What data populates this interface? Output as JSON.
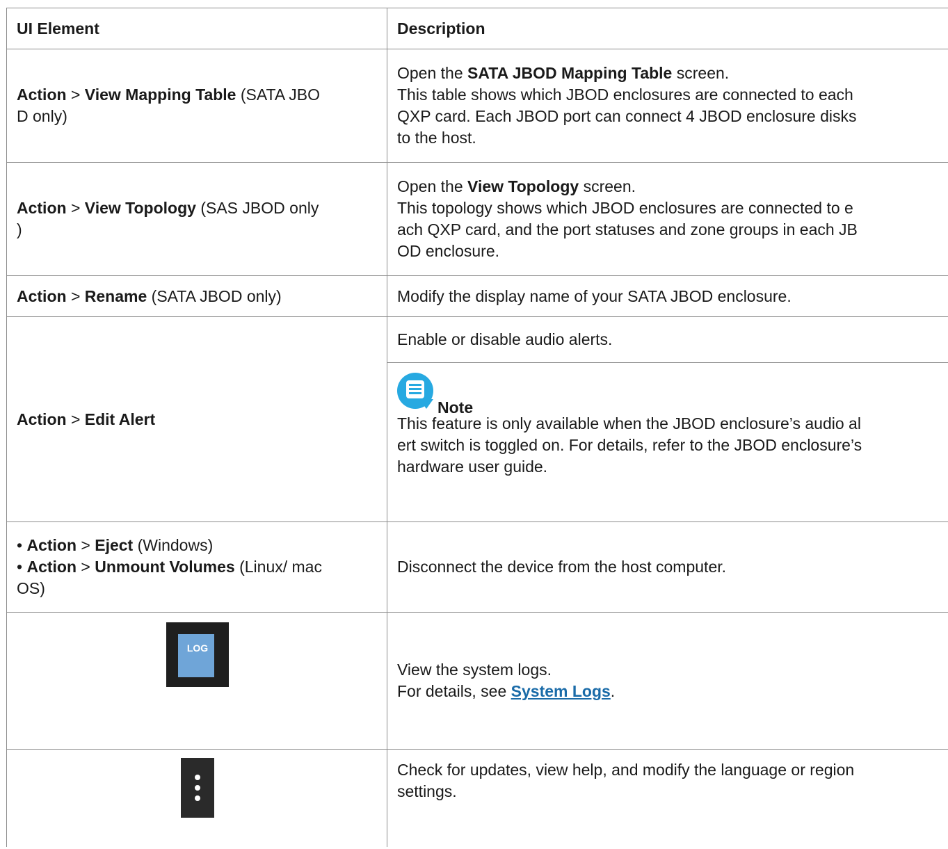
{
  "header": {
    "col1": "UI Element",
    "col2": "Description"
  },
  "rows": {
    "mapping": {
      "action": "Action",
      "sep": ">",
      "item": "View Mapping Table",
      "note1": "(SATA JBO",
      "note2": "D only)",
      "d_open": "Open the",
      "d_bold": "SATA JBOD Mapping Table",
      "d_screen": "screen.",
      "d_l2": "This table shows which JBOD enclosures are connected to each",
      "d_l3": "QXP card. Each JBOD port can connect 4 JBOD enclosure disks",
      "d_l4": "to the host."
    },
    "topology": {
      "action": "Action",
      "sep": ">",
      "item": "View Topology",
      "note1": "(SAS JBOD only",
      "note2": ")",
      "d_open": "Open the",
      "d_bold": "View Topology",
      "d_screen": "screen.",
      "d_l2": "This topology shows which JBOD enclosures are connected to e",
      "d_l3": "ach QXP card, and the port statuses and zone groups in each JB",
      "d_l4": "OD enclosure."
    },
    "rename": {
      "action": "Action",
      "sep": ">",
      "item": "Rename",
      "note": "(SATA JBOD only)",
      "desc": "Modify the display name of your SATA JBOD enclosure."
    },
    "alert": {
      "action": "Action",
      "sep": ">",
      "item": "Edit Alert",
      "desc": "Enable or disable audio alerts.",
      "note_label": "Note",
      "n_l1": "This feature is only available when the JBOD enclosure’s audio al",
      "n_l2": "ert switch is toggled on. For details, refer to the JBOD enclosure’s",
      "n_l3": "hardware user guide."
    },
    "eject": {
      "bullet": "•",
      "action": "Action",
      "sep": ">",
      "item1": "Eject",
      "note1": "(Windows)",
      "item2": "Unmount Volumes",
      "note2a": "(Linux/ mac",
      "note2b": "OS)",
      "desc": "Disconnect the device from the host computer."
    },
    "logs": {
      "icon_text": "LOG",
      "d_l1": "View the system logs.",
      "d_l2_pre": "For details, see",
      "link": "System Logs",
      "d_l2_post": "."
    },
    "more": {
      "d_l1": "Check for updates, view help, and modify the language or region",
      "d_l2": "settings."
    }
  },
  "colors": {
    "link": "#1a6ba8",
    "note_icon": "#27a9e1",
    "border": "#8c8c8c"
  },
  "icons": {
    "log": "log-file-icon",
    "more": "more-vertical-icon",
    "note": "note-icon"
  }
}
